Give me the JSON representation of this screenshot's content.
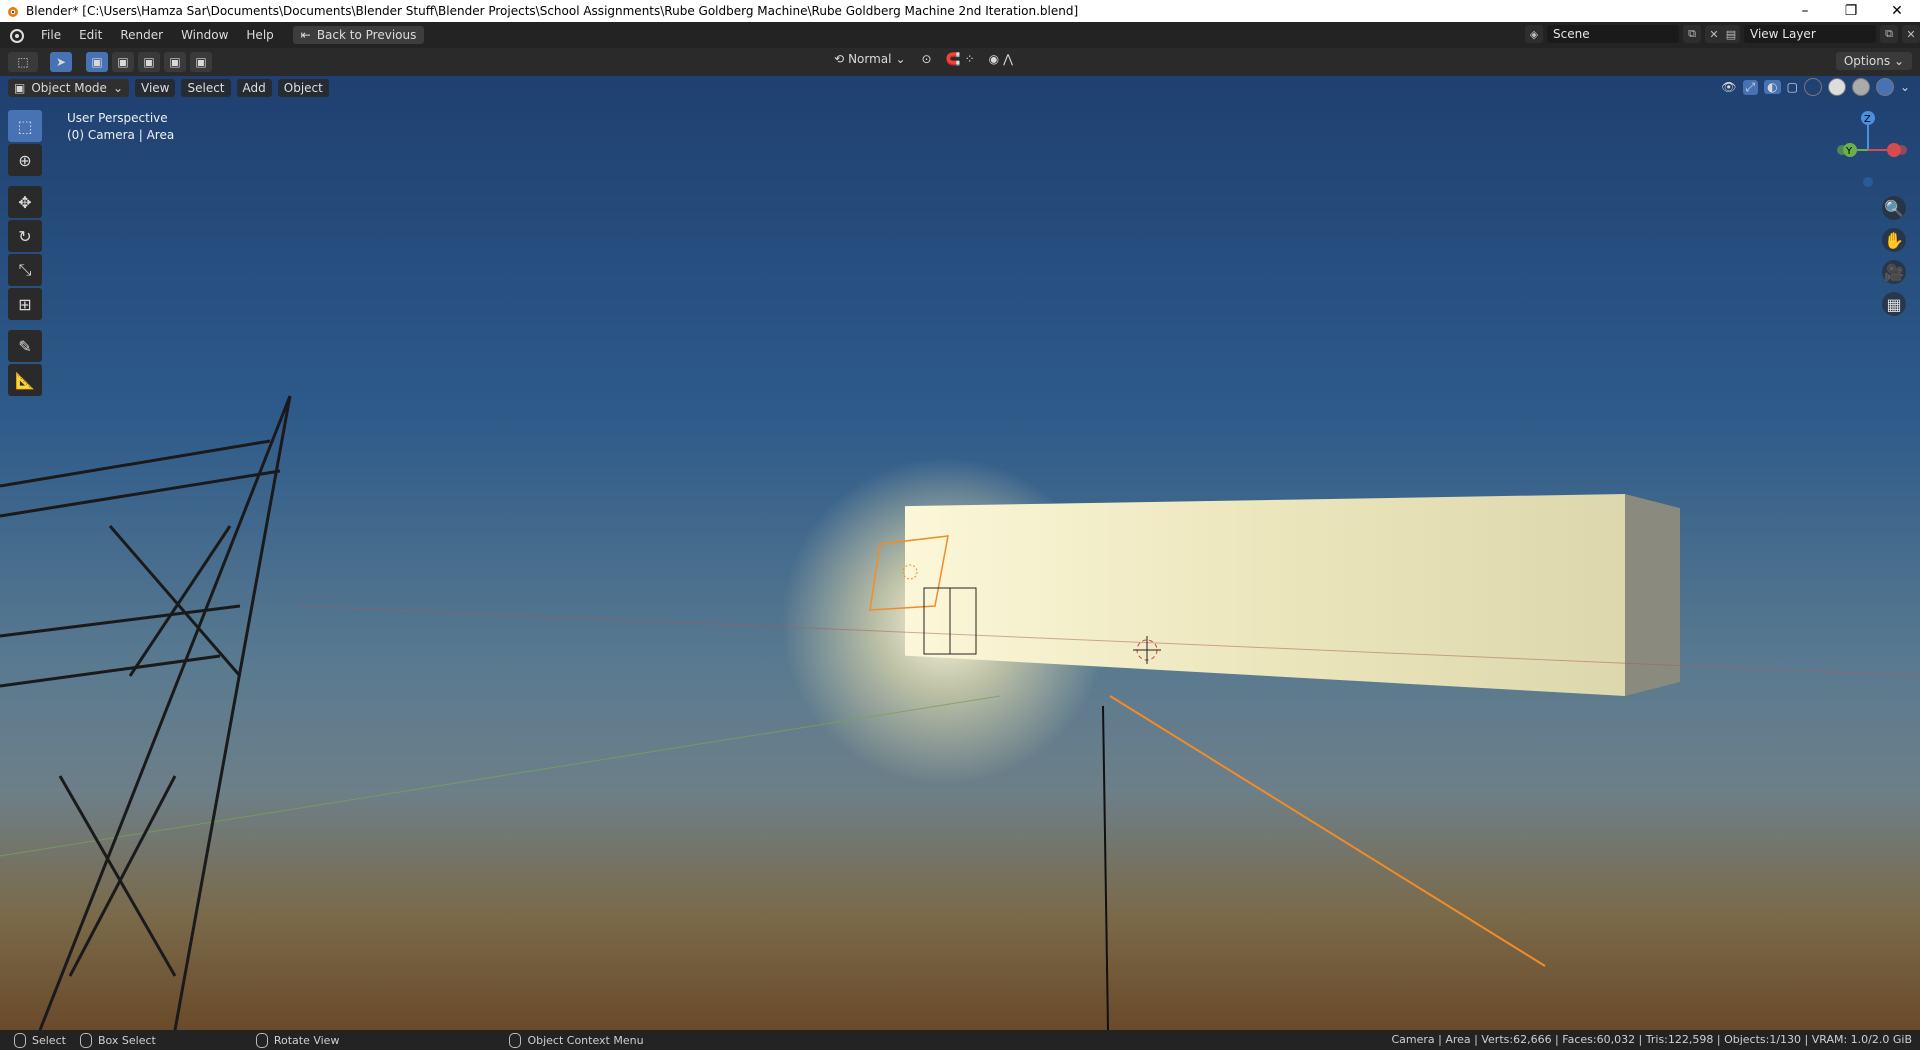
{
  "window": {
    "title": "Blender* [C:\\Users\\Hamza Sar\\Documents\\Documents\\Blender Stuff\\Blender Projects\\School Assignments\\Rube Goldberg Machine\\Rube Goldberg Machine 2nd Iteration.blend]",
    "minimize": "–",
    "restore": "❐",
    "close": "✕"
  },
  "menubar": {
    "items": [
      "File",
      "Edit",
      "Render",
      "Window",
      "Help"
    ],
    "back_button": "Back to Previous",
    "scene_label": "Scene",
    "view_layer_label": "View Layer"
  },
  "toolheader": {
    "orientation": "Normal",
    "options": "Options"
  },
  "viewport_header": {
    "mode": "Object Mode",
    "menus": [
      "View",
      "Select",
      "Add",
      "Object"
    ]
  },
  "viewport": {
    "perspective": "User Perspective",
    "active_object": "(0) Camera | Area"
  },
  "gizmo": {
    "z": "Z",
    "y": "Y"
  },
  "statusbar": {
    "select": "Select",
    "box_select": "Box Select",
    "rotate_view": "Rotate View",
    "context_menu": "Object Context Menu",
    "stats": "Camera | Area | Verts:62,666 | Faces:60,032 | Tris:122,598 | Objects:1/130 | VRAM: 1.0/2.0 GiB"
  },
  "colors": {
    "accent": "#4772b3",
    "selection": "#f28c28"
  }
}
